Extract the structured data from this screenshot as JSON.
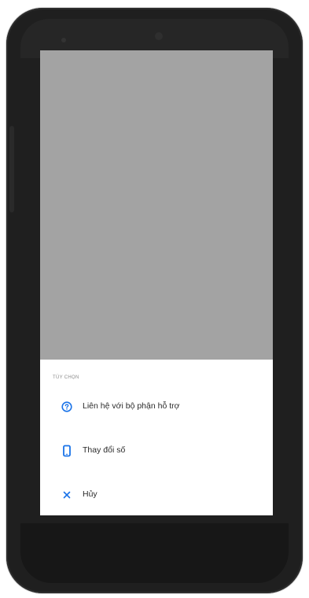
{
  "sheet": {
    "title": "TÙY CHỌN",
    "options": [
      {
        "label": "Liên hệ với bộ phận hỗ trợ",
        "icon": "help-circle-icon"
      },
      {
        "label": "Thay đổi số",
        "icon": "phone-device-icon"
      },
      {
        "label": "Hủy",
        "icon": "close-icon"
      }
    ]
  },
  "colors": {
    "accent": "#1a73e8",
    "scrim": "#a3a3a3",
    "phone_body": "#1f1f1f"
  }
}
